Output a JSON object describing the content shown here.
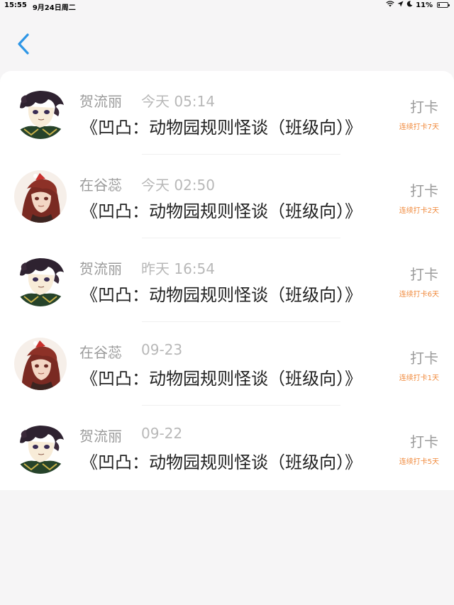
{
  "status_bar": {
    "time": "15:55",
    "date": "9月24日周二",
    "battery": "11%"
  },
  "items": [
    {
      "name": "贺流丽",
      "time": "今天 05:14",
      "title": "《凹凸：动物园规则怪谈（班级向）》",
      "action": "打卡",
      "streak": "连续打卡7天",
      "avatar": "boy"
    },
    {
      "name": "在谷蕊",
      "time": "今天 02:50",
      "title": "《凹凸：动物园规则怪谈（班级向）》",
      "action": "打卡",
      "streak": "连续打卡2天",
      "avatar": "girl"
    },
    {
      "name": "贺流丽",
      "time": "昨天 16:54",
      "title": "《凹凸：动物园规则怪谈（班级向）》",
      "action": "打卡",
      "streak": "连续打卡6天",
      "avatar": "boy"
    },
    {
      "name": "在谷蕊",
      "time": "09-23",
      "title": "《凹凸：动物园规则怪谈（班级向）》",
      "action": "打卡",
      "streak": "连续打卡1天",
      "avatar": "girl"
    },
    {
      "name": "贺流丽",
      "time": "09-22",
      "title": "《凹凸：动物园规则怪谈（班级向）》",
      "action": "打卡",
      "streak": "连续打卡5天",
      "avatar": "boy"
    }
  ]
}
